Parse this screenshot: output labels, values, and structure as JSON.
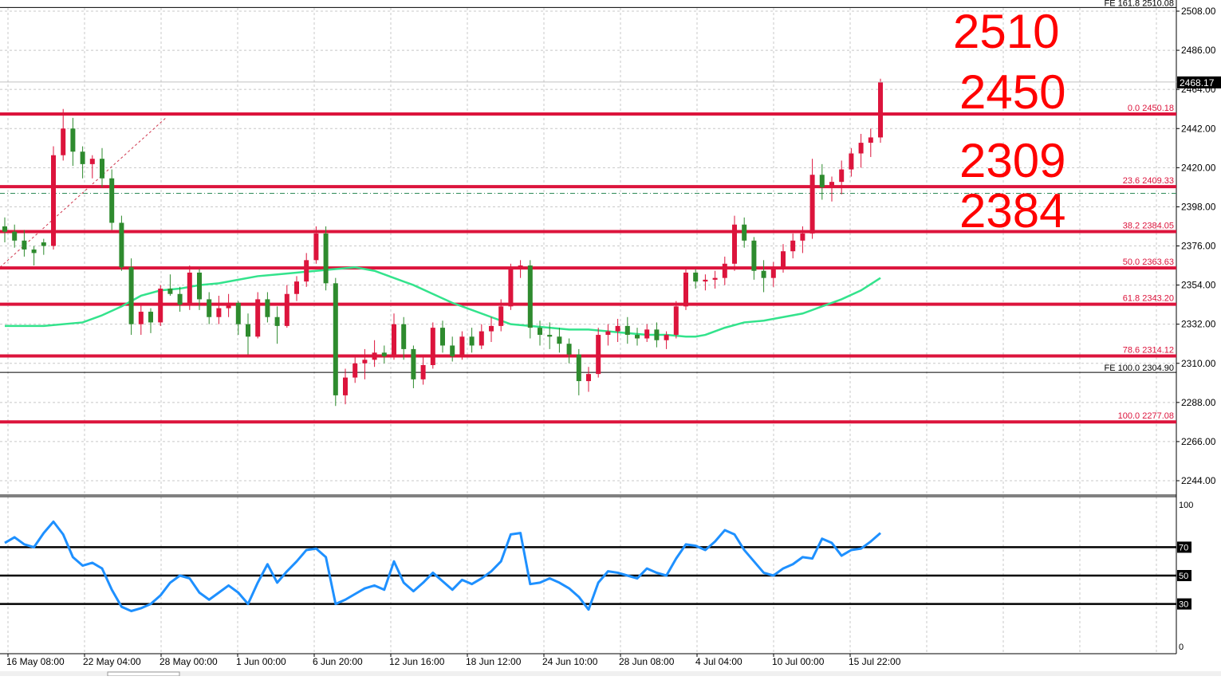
{
  "chart_data": [
    {
      "type": "candlestick",
      "instrument_hint": "gold",
      "price_axis": {
        "ylim": [
          2224,
          2512
        ],
        "ticks": [
          "2508.00",
          "2486.00",
          "2464.00",
          "2442.00",
          "2420.00",
          "2398.00",
          "2376.00",
          "2354.00",
          "2332.00",
          "2310.00",
          "2288.00",
          "2266.00",
          "2244.00"
        ],
        "tick_values": [
          2508,
          2486,
          2464,
          2442,
          2420,
          2398,
          2376,
          2354,
          2332,
          2310,
          2288,
          2266,
          2244
        ]
      },
      "time_axis": {
        "labels": [
          "16 May 08:00",
          "22 May 04:00",
          "28 May 00:00",
          "1 Jun 00:00",
          "6 Jun 20:00",
          "12 Jun 16:00",
          "18 Jun 12:00",
          "24 Jun 10:00",
          "28 Jun 08:00",
          "4 Jul 04:00",
          "10 Jul 00:00",
          "15 Jul 22:00"
        ]
      },
      "current_price": {
        "label": "2468.17",
        "value": 2468.17
      },
      "bid_line_value": 2405.6,
      "fib_levels": [
        {
          "label": "0.0 2450.18",
          "value": 2450.18,
          "bold": true
        },
        {
          "label": "23.6 2409.33",
          "value": 2409.33,
          "bold": true
        },
        {
          "label": "38.2 2384.05",
          "value": 2384.05,
          "bold": true
        },
        {
          "label": "50.0 2363.63",
          "value": 2363.63,
          "bold": true
        },
        {
          "label": "61.8 2343.20",
          "value": 2343.2,
          "bold": true
        },
        {
          "label": "78.6 2314.12",
          "value": 2314.12,
          "bold": true
        },
        {
          "label": "100.0 2277.08",
          "value": 2277.08,
          "bold": true
        }
      ],
      "fe_levels": [
        {
          "label": "FE 161.8 2510.08",
          "value": 2510.08
        },
        {
          "label": "FE 100.0 2304.90",
          "value": 2304.9
        }
      ],
      "annotations": [
        "2510",
        "2450",
        "2309",
        "2384"
      ],
      "moving_average": {
        "color": "#33e38c",
        "points": [
          [
            0,
            2331
          ],
          [
            4,
            2331
          ],
          [
            8,
            2333
          ],
          [
            10,
            2337
          ],
          [
            12,
            2342
          ],
          [
            14,
            2348
          ],
          [
            16,
            2351
          ],
          [
            18,
            2352
          ],
          [
            20,
            2354
          ],
          [
            22,
            2355
          ],
          [
            24,
            2357
          ],
          [
            26,
            2359
          ],
          [
            28,
            2360
          ],
          [
            30,
            2361
          ],
          [
            32,
            2362
          ],
          [
            34,
            2363
          ],
          [
            36,
            2364
          ],
          [
            38,
            2362
          ],
          [
            40,
            2358
          ],
          [
            42,
            2354
          ],
          [
            44,
            2349
          ],
          [
            46,
            2344
          ],
          [
            48,
            2340
          ],
          [
            50,
            2336
          ],
          [
            52,
            2332
          ],
          [
            54,
            2331
          ],
          [
            56,
            2330
          ],
          [
            58,
            2329
          ],
          [
            60,
            2329
          ],
          [
            62,
            2328
          ],
          [
            64,
            2327
          ],
          [
            66,
            2326
          ],
          [
            68,
            2326
          ],
          [
            70,
            2325
          ],
          [
            71,
            2325
          ],
          [
            72,
            2326
          ],
          [
            74,
            2330
          ],
          [
            76,
            2333
          ],
          [
            78,
            2334
          ],
          [
            80,
            2336
          ],
          [
            82,
            2338
          ],
          [
            84,
            2342
          ],
          [
            86,
            2346
          ],
          [
            88,
            2351
          ],
          [
            90,
            2358
          ]
        ]
      },
      "candles": [
        [
          0,
          2387,
          2392,
          2378,
          2384
        ],
        [
          1,
          2384,
          2388,
          2375,
          2379
        ],
        [
          2,
          2379,
          2385,
          2370,
          2374
        ],
        [
          3,
          2374,
          2376,
          2365,
          2372
        ],
        [
          4,
          2378,
          2380,
          2371,
          2376
        ],
        [
          5,
          2376,
          2432,
          2374,
          2427
        ],
        [
          6,
          2427,
          2453,
          2424,
          2442
        ],
        [
          7,
          2442,
          2448,
          2421,
          2429
        ],
        [
          8,
          2429,
          2432,
          2414,
          2422
        ],
        [
          9,
          2422,
          2427,
          2414,
          2425
        ],
        [
          10,
          2425,
          2431,
          2409,
          2414
        ],
        [
          11,
          2414,
          2419,
          2385,
          2389
        ],
        [
          12,
          2389,
          2393,
          2362,
          2364
        ],
        [
          13,
          2364,
          2369,
          2326,
          2332
        ],
        [
          14,
          2332,
          2343,
          2326,
          2339
        ],
        [
          15,
          2339,
          2341,
          2327,
          2333
        ],
        [
          16,
          2333,
          2354,
          2331,
          2352
        ],
        [
          17,
          2352,
          2360,
          2348,
          2349
        ],
        [
          18,
          2349,
          2353,
          2339,
          2343
        ],
        [
          19,
          2343,
          2365,
          2340,
          2361
        ],
        [
          20,
          2361,
          2363,
          2340,
          2346
        ],
        [
          21,
          2346,
          2350,
          2332,
          2336
        ],
        [
          22,
          2336,
          2348,
          2332,
          2341
        ],
        [
          23,
          2341,
          2349,
          2336,
          2344
        ],
        [
          24,
          2344,
          2345,
          2326,
          2332
        ],
        [
          25,
          2332,
          2338,
          2315,
          2325
        ],
        [
          26,
          2325,
          2350,
          2324,
          2346
        ],
        [
          27,
          2346,
          2350,
          2333,
          2336
        ],
        [
          28,
          2336,
          2342,
          2321,
          2331
        ],
        [
          29,
          2331,
          2354,
          2330,
          2349
        ],
        [
          30,
          2349,
          2359,
          2345,
          2356
        ],
        [
          31,
          2356,
          2372,
          2353,
          2368
        ],
        [
          32,
          2368,
          2387,
          2366,
          2383
        ],
        [
          33,
          2383,
          2387,
          2351,
          2355
        ],
        [
          34,
          2355,
          2358,
          2286,
          2292
        ],
        [
          35,
          2292,
          2307,
          2287,
          2302
        ],
        [
          36,
          2302,
          2314,
          2299,
          2310
        ],
        [
          37,
          2310,
          2318,
          2301,
          2312
        ],
        [
          38,
          2312,
          2323,
          2308,
          2316
        ],
        [
          39,
          2316,
          2320,
          2310,
          2314
        ],
        [
          40,
          2314,
          2338,
          2312,
          2332
        ],
        [
          41,
          2332,
          2336,
          2312,
          2318
        ],
        [
          42,
          2318,
          2320,
          2296,
          2301
        ],
        [
          43,
          2301,
          2314,
          2298,
          2309
        ],
        [
          44,
          2309,
          2333,
          2307,
          2330
        ],
        [
          45,
          2330,
          2334,
          2316,
          2320
        ],
        [
          46,
          2320,
          2325,
          2311,
          2314
        ],
        [
          47,
          2314,
          2328,
          2312,
          2325
        ],
        [
          48,
          2325,
          2330,
          2316,
          2320
        ],
        [
          49,
          2320,
          2332,
          2318,
          2328
        ],
        [
          50,
          2328,
          2336,
          2322,
          2331
        ],
        [
          51,
          2331,
          2346,
          2328,
          2342
        ],
        [
          52,
          2342,
          2366,
          2340,
          2363
        ],
        [
          53,
          2363,
          2368,
          2358,
          2365
        ],
        [
          54,
          2365,
          2368,
          2324,
          2330
        ],
        [
          55,
          2330,
          2334,
          2320,
          2326
        ],
        [
          56,
          2326,
          2333,
          2318,
          2325
        ],
        [
          57,
          2325,
          2330,
          2316,
          2321
        ],
        [
          58,
          2321,
          2324,
          2310,
          2315
        ],
        [
          59,
          2315,
          2318,
          2292,
          2300
        ],
        [
          60,
          2300,
          2308,
          2294,
          2304
        ],
        [
          61,
          2304,
          2330,
          2302,
          2326
        ],
        [
          62,
          2326,
          2332,
          2320,
          2328
        ],
        [
          63,
          2328,
          2335,
          2322,
          2331
        ],
        [
          64,
          2331,
          2336,
          2321,
          2326
        ],
        [
          65,
          2326,
          2330,
          2320,
          2324
        ],
        [
          66,
          2324,
          2332,
          2322,
          2329
        ],
        [
          67,
          2329,
          2333,
          2319,
          2323
        ],
        [
          68,
          2323,
          2328,
          2318,
          2326
        ],
        [
          69,
          2326,
          2345,
          2324,
          2342
        ],
        [
          70,
          2342,
          2364,
          2340,
          2361
        ],
        [
          71,
          2361,
          2363,
          2352,
          2356
        ],
        [
          72,
          2356,
          2360,
          2351,
          2357
        ],
        [
          73,
          2357,
          2362,
          2352,
          2358
        ],
        [
          74,
          2358,
          2370,
          2354,
          2366
        ],
        [
          75,
          2366,
          2393,
          2362,
          2388
        ],
        [
          76,
          2388,
          2392,
          2375,
          2379
        ],
        [
          77,
          2379,
          2381,
          2357,
          2362
        ],
        [
          78,
          2362,
          2368,
          2350,
          2358
        ],
        [
          79,
          2358,
          2367,
          2353,
          2364
        ],
        [
          80,
          2364,
          2377,
          2361,
          2373
        ],
        [
          81,
          2373,
          2383,
          2369,
          2379
        ],
        [
          82,
          2379,
          2387,
          2372,
          2383
        ],
        [
          83,
          2383,
          2425,
          2380,
          2416
        ],
        [
          84,
          2416,
          2422,
          2402,
          2409
        ],
        [
          85,
          2409,
          2415,
          2401,
          2412
        ],
        [
          86,
          2412,
          2424,
          2405,
          2419
        ],
        [
          87,
          2419,
          2431,
          2415,
          2428
        ],
        [
          88,
          2428,
          2439,
          2420,
          2434
        ],
        [
          89,
          2434,
          2442,
          2426,
          2437
        ],
        [
          90,
          2437,
          2470,
          2434,
          2468
        ]
      ]
    },
    {
      "type": "line",
      "series": [
        {
          "values": [
            73,
            77,
            72,
            70,
            80,
            88,
            79,
            63,
            57,
            59,
            55,
            40,
            28,
            25,
            27,
            30,
            36,
            45,
            50,
            48,
            38,
            33,
            38,
            43,
            38,
            30,
            45,
            58,
            45,
            53,
            60,
            68,
            69,
            63,
            30,
            33,
            37,
            41,
            43,
            40,
            60,
            45,
            39,
            45,
            52,
            46,
            40,
            47,
            44,
            48,
            53,
            60,
            79,
            80,
            44,
            45,
            48,
            45,
            41,
            35,
            26,
            45,
            53,
            52,
            50,
            48,
            55,
            52,
            50,
            62,
            72,
            71,
            68,
            74,
            82,
            79,
            68,
            60,
            52,
            50,
            55,
            58,
            63,
            62,
            76,
            73,
            64,
            68,
            69,
            74,
            80
          ]
        }
      ],
      "color": "#1e90ff",
      "ylim": [
        0,
        100
      ],
      "ticks": [
        "100",
        "0"
      ],
      "levels": [
        {
          "label": "70",
          "value": 70
        },
        {
          "label": "50",
          "value": 50
        },
        {
          "label": "30",
          "value": 30
        }
      ]
    }
  ]
}
